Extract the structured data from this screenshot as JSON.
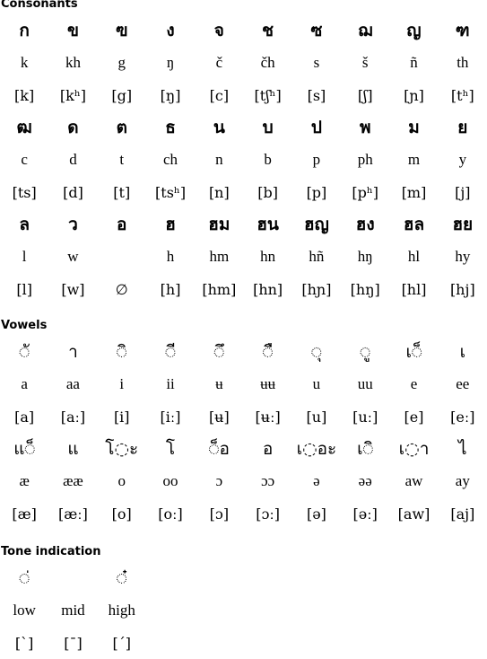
{
  "sections": {
    "consonants": {
      "title": "Consonants",
      "rows": [
        {
          "script": [
            "ก",
            "ข",
            "ฃ",
            "ง",
            "จ",
            "ช",
            "ซ",
            "ฌ",
            "ญ",
            "ฑ"
          ],
          "latin": [
            "k",
            "kh",
            "g",
            "ŋ",
            "č",
            "čh",
            "s",
            "š",
            "ñ",
            "th"
          ],
          "ipa": [
            "[k]",
            "[kʰ]",
            "[g]",
            "[ŋ]",
            "[c]",
            "[tʃʰ]",
            "[s]",
            "[ʃ]",
            "[ɲ]",
            "[tʰ]"
          ]
        },
        {
          "script": [
            "ฒ",
            "ด",
            "ต",
            "ธ",
            "น",
            "บ",
            "ป",
            "พ",
            "ม",
            "ย"
          ],
          "latin": [
            "c",
            "d",
            "t",
            "ch",
            "n",
            "b",
            "p",
            "ph",
            "m",
            "y"
          ],
          "ipa": [
            "[ts]",
            "[d]",
            "[t]",
            "[tsʰ]",
            "[n]",
            "[b]",
            "[p]",
            "[pʰ]",
            "[m]",
            "[j]"
          ]
        },
        {
          "script": [
            "ล",
            "ว",
            "อ",
            "ฮ",
            "ฮม",
            "ฮน",
            "ฮญ",
            "ฮง",
            "ฮล",
            "ฮย"
          ],
          "latin": [
            "l",
            "w",
            "",
            "h",
            "hm",
            "hn",
            "hñ",
            "hŋ",
            "hl",
            "hy"
          ],
          "ipa": [
            "[l]",
            "[w]",
            "∅",
            "[h]",
            "[hm]",
            "[hn]",
            "[hɲ]",
            "[hŋ]",
            "[hl]",
            "[hj]"
          ]
        }
      ]
    },
    "vowels": {
      "title": "Vowels",
      "rows": [
        {
          "script": [
            "◌ั",
            "า",
            "◌ิ",
            "◌ี",
            "◌ึ",
            "◌ื",
            "◌ุ",
            "◌ู",
            "เ◌็",
            "เ"
          ],
          "latin": [
            "a",
            "aa",
            "i",
            "ii",
            "ʉ",
            "ʉʉ",
            "u",
            "uu",
            "e",
            "ee"
          ],
          "ipa": [
            "[a]",
            "[aː]",
            "[i]",
            "[iː]",
            "[ʉ]",
            "[ʉː]",
            "[u]",
            "[uː]",
            "[e]",
            "[eː]"
          ]
        },
        {
          "script": [
            "แ◌็",
            "แ",
            "โ◌ะ",
            "โ",
            "◌็อ",
            "อ",
            "เ◌อะ",
            "เ◌ิ",
            "เ◌า",
            "ไ"
          ],
          "latin": [
            "æ",
            "ææ",
            "o",
            "oo",
            "ɔ",
            "ɔɔ",
            "ə",
            "əə",
            "aw",
            "ay"
          ],
          "ipa": [
            "[æ]",
            "[æː]",
            "[o]",
            "[oː]",
            "[ɔ]",
            "[ɔː]",
            "[ə]",
            "[əː]",
            "[aw]",
            "[aj]"
          ]
        }
      ]
    },
    "tones": {
      "title": "Tone indication",
      "rows": [
        {
          "script": [
            "◌่",
            "",
            "◌๋"
          ],
          "latin": [
            "low",
            "mid",
            "high"
          ],
          "ipa": [
            "[ˋ]",
            "[¯]",
            "[ˊ]"
          ]
        }
      ]
    }
  }
}
